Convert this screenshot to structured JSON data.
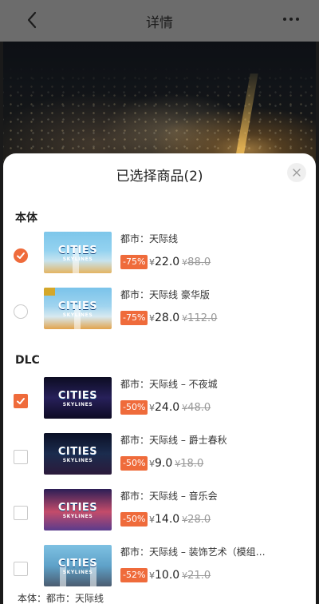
{
  "header": {
    "title": "详情"
  },
  "sheet": {
    "title": "已选择商品(2)",
    "sections": [
      {
        "label": "本体",
        "items": [
          {
            "thumb_text": "CITIES",
            "thumb_sub": "SKYLINES",
            "name": "都市：天际线",
            "discount": "-75%",
            "currency": "¥",
            "price": "22.0",
            "original": "88.0",
            "selected": true
          },
          {
            "thumb_text": "CITIES",
            "thumb_sub": "SKYLINES",
            "name": "都市：天际线 豪华版",
            "discount": "-75%",
            "currency": "¥",
            "price": "28.0",
            "original": "112.0",
            "selected": false
          }
        ]
      },
      {
        "label": "DLC",
        "items": [
          {
            "thumb_text": "CITIES",
            "thumb_sub": "SKYLINES",
            "name": "都市：天际线 – 不夜城",
            "discount": "-50%",
            "currency": "¥",
            "price": "24.0",
            "original": "48.0",
            "selected": true
          },
          {
            "thumb_text": "CITIES",
            "thumb_sub": "SKYLINES",
            "name": "都市：天际线 – 爵士春秋",
            "discount": "-50%",
            "currency": "¥",
            "price": "9.0",
            "original": "18.0",
            "selected": false
          },
          {
            "thumb_text": "CITIES",
            "thumb_sub": "SKYLINES",
            "name": "都市：天际线 – 音乐会",
            "discount": "-50%",
            "currency": "¥",
            "price": "14.0",
            "original": "28.0",
            "selected": false
          },
          {
            "thumb_text": "CITIES",
            "thumb_sub": "SKYLINES",
            "name": "都市：天际线 – 装饰艺术（模组…",
            "discount": "-52%",
            "currency": "¥",
            "price": "10.0",
            "original": "21.0",
            "selected": false
          }
        ]
      }
    ],
    "footer_peek": "本体：都市：天际线"
  },
  "colors": {
    "accent": "#ef6b3b",
    "header_bg": "#6c6c6c"
  },
  "icons": {
    "back": "chevron-left-icon",
    "more": "more-dots-icon",
    "close": "close-icon",
    "check": "check-icon"
  }
}
